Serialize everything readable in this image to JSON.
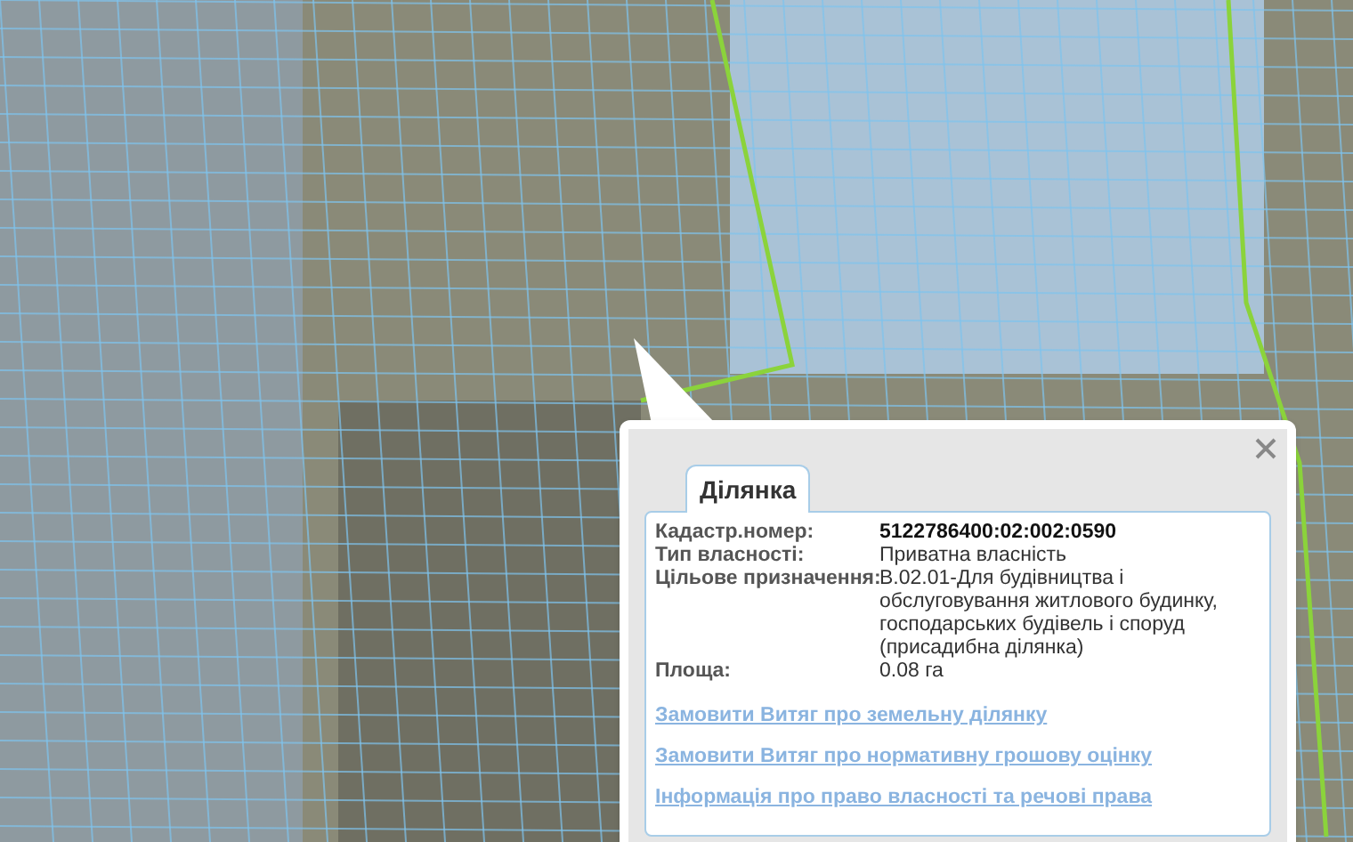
{
  "popup": {
    "tabs": [
      {
        "label": "Ділянка",
        "selected": true
      }
    ],
    "fields": [
      {
        "label": "Кадастр.номер:",
        "value": "5122786400:02:002:0590",
        "kind": "strong"
      },
      {
        "label": "Тип власності:",
        "value": "Приватна власність",
        "kind": "plain"
      },
      {
        "label": "Цільове призначення:",
        "value": "В.02.01-Для будівництва і обслуговування житлового будинку, господарських будівель і споруд (присадибна ділянка)",
        "kind": "plain"
      },
      {
        "label": "Площа:",
        "value": "0.08 га",
        "kind": "plain"
      }
    ],
    "links": [
      "Замовити Витяг про земельну ділянку",
      "Замовити Витяг про нормативну грошову оцінку",
      "Інформація про право власності та речові права"
    ]
  }
}
